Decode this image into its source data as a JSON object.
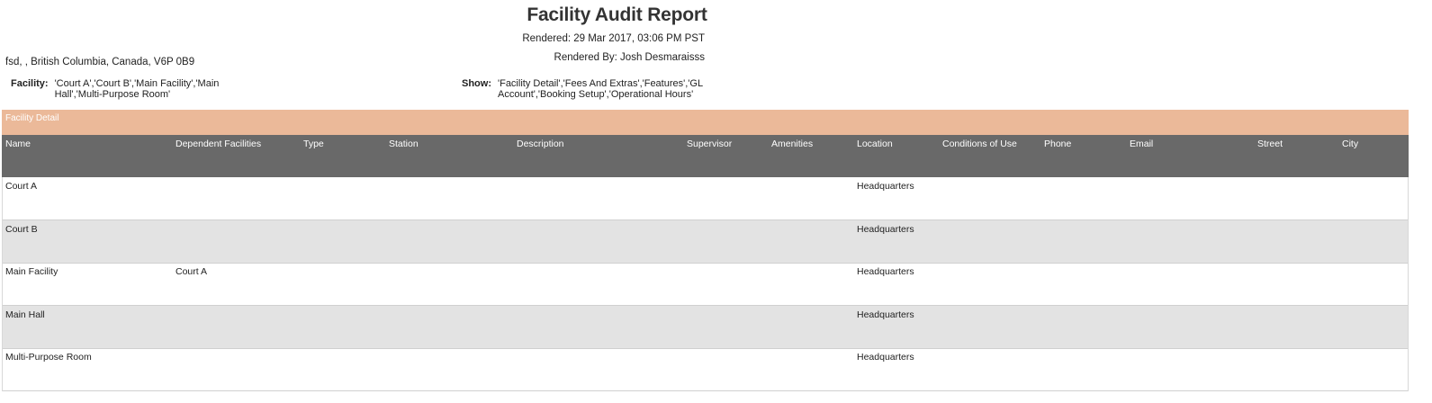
{
  "report": {
    "title": "Facility Audit Report",
    "rendered": "Rendered: 29 Mar 2017, 03:06 PM PST",
    "rendered_by": "Rendered By: Josh Desmaraisss",
    "address": "fsd, , British Columbia, Canada, V6P 0B9"
  },
  "filters": {
    "facility_label": "Facility:",
    "facility_value": "'Court A','Court B','Main Facility','Main Hall','Multi-Purpose Room'",
    "show_label": "Show:",
    "show_value": "'Facility Detail','Fees And Extras','Features','GL Account','Booking Setup','Operational Hours'"
  },
  "section": {
    "title": "Facility Detail"
  },
  "table": {
    "columns": [
      "Name",
      "Dependent Facilities",
      "Type",
      "Station",
      "Description",
      "Supervisor",
      "Amenities",
      "Location",
      "Conditions of Use",
      "Phone",
      "Email",
      "Street",
      "City"
    ],
    "rows": [
      {
        "name": "Court A",
        "dependent": "",
        "location": "Headquarters"
      },
      {
        "name": "Court B",
        "dependent": "",
        "location": "Headquarters"
      },
      {
        "name": "Main Facility",
        "dependent": "Court A",
        "location": "Headquarters"
      },
      {
        "name": "Main Hall",
        "dependent": "",
        "location": "Headquarters"
      },
      {
        "name": "Multi-Purpose Room",
        "dependent": "",
        "location": "Headquarters"
      }
    ]
  },
  "colors": {
    "section_bar": "#ebb999",
    "header_bg": "#696969",
    "alt_row": "#e3e3e3"
  }
}
